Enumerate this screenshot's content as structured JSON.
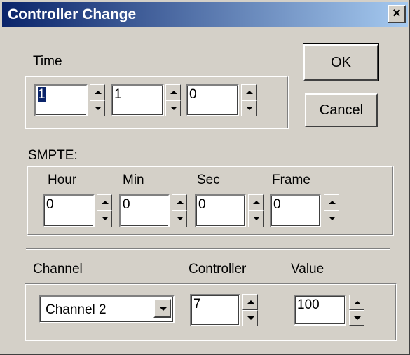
{
  "window": {
    "title": "Controller Change",
    "close_glyph": "×"
  },
  "buttons": {
    "ok": "OK",
    "cancel": "Cancel"
  },
  "time": {
    "label": "Time",
    "measure": "1",
    "beat": "1",
    "tick": "0"
  },
  "smpte": {
    "label": "SMPTE:",
    "hour_label": "Hour",
    "min_label": "Min",
    "sec_label": "Sec",
    "frame_label": "Frame",
    "hour": "0",
    "min": "0",
    "sec": "0",
    "frame": "0"
  },
  "event": {
    "channel_label": "Channel",
    "controller_label": "Controller",
    "value_label": "Value",
    "channel": "Channel 2",
    "controller": "7",
    "value": "100"
  },
  "icons": {
    "spin_up": "arrow-up-icon",
    "spin_down": "arrow-down-icon",
    "dropdown": "chevron-down-icon",
    "close": "close-icon"
  },
  "colors": {
    "titlebar_start": "#0a246a",
    "titlebar_end": "#a6caf0",
    "face": "#d4d0c8"
  }
}
